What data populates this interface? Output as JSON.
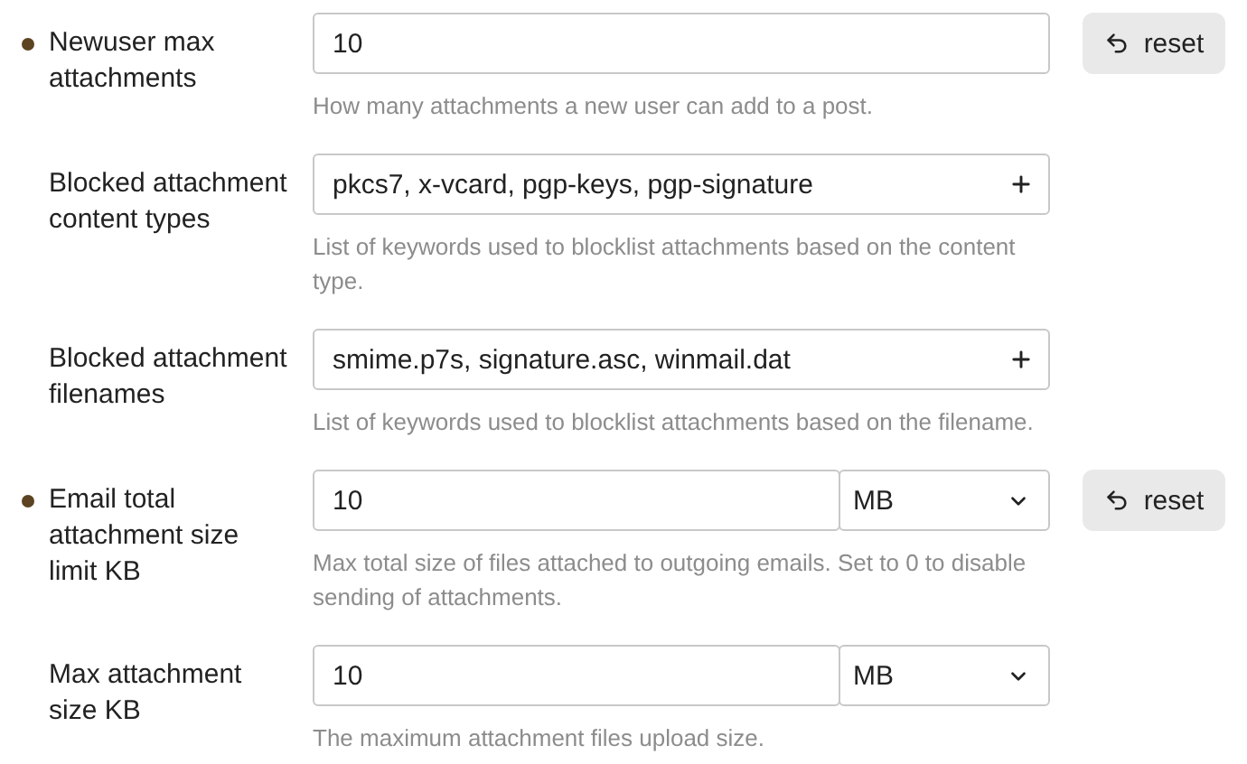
{
  "settings": [
    {
      "label": "Newuser max attachments",
      "kind": "number",
      "value": "10",
      "description": "How many attachments a new user can add to a post.",
      "modified": true,
      "reset": "reset"
    },
    {
      "label": "Blocked attachment content types",
      "kind": "list",
      "value": "pkcs7, x-vcard, pgp-keys, pgp-signature",
      "description": "List of keywords used to blocklist attachments based on the content type.",
      "modified": false
    },
    {
      "label": "Blocked attachment filenames",
      "kind": "list",
      "value": "smime.p7s, signature.asc, winmail.dat",
      "description": "List of keywords used to blocklist attachments based on the filename.",
      "modified": false
    },
    {
      "label": "Email total attachment size limit KB",
      "kind": "unit",
      "value": "10",
      "unit": "MB",
      "description": "Max total size of files attached to outgoing emails. Set to 0 to disable sending of attachments.",
      "modified": true,
      "reset": "reset"
    },
    {
      "label": "Max attachment size KB",
      "kind": "unit",
      "value": "10",
      "unit": "MB",
      "description": "The maximum attachment files upload size.",
      "modified": false
    }
  ]
}
